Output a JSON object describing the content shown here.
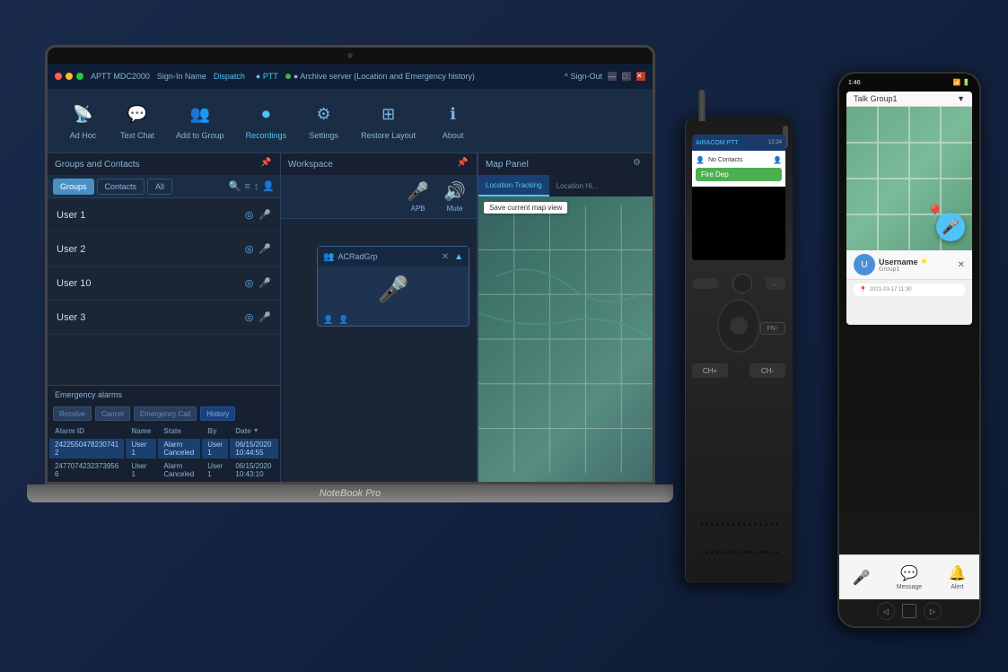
{
  "app": {
    "title": "APTT MDC2000",
    "sign_in_label": "Sign-In Name",
    "user": "Dispatch",
    "ptt_label": "● PTT",
    "archive_label": "● Archive server (Location and Emergency history)",
    "sign_out_label": "^ Sign-Out"
  },
  "toolbar": {
    "items": [
      {
        "id": "adhoc",
        "label": "Ad Hoc",
        "icon": "📡"
      },
      {
        "id": "textchat",
        "label": "Text Chat",
        "icon": "💬"
      },
      {
        "id": "addtogroup",
        "label": "Add to Group",
        "icon": "👥"
      },
      {
        "id": "recordings",
        "label": "Recordings",
        "icon": "⏺"
      },
      {
        "id": "settings",
        "label": "Settings",
        "icon": "⚙"
      },
      {
        "id": "restorelayout",
        "label": "Restore Layout",
        "icon": "⊞"
      },
      {
        "id": "about",
        "label": "About",
        "icon": "ℹ"
      }
    ]
  },
  "groups_panel": {
    "title": "Groups and Contacts",
    "tabs": [
      "Groups",
      "Contacts",
      "All"
    ],
    "active_tab": "Groups",
    "contacts": [
      {
        "name": "User 1",
        "has_location": true,
        "mic_color": "green"
      },
      {
        "name": "User 2",
        "has_location": true,
        "mic_color": "green"
      },
      {
        "name": "User 10",
        "has_location": true,
        "mic_color": "red"
      },
      {
        "name": "User 3",
        "has_location": true,
        "mic_color": "red"
      }
    ]
  },
  "alarms": {
    "title": "Emergency alarms",
    "buttons": [
      "Receive",
      "Cancel",
      "Emergency Call",
      "History"
    ],
    "columns": [
      "Alarm ID",
      "Name",
      "State",
      "By",
      "Date"
    ],
    "rows": [
      {
        "id": "2422550478230741 2",
        "name": "User 1",
        "state": "Alarm Canceled",
        "by": "User 1",
        "date": "06/15/2020 10:44:55",
        "selected": true
      },
      {
        "id": "2477074232373956 6",
        "name": "User 1",
        "state": "Alarm Canceled",
        "by": "User 1",
        "date": "06/15/2020 10:43:10",
        "selected": false
      }
    ]
  },
  "workspace": {
    "title": "Workspace",
    "apb_label": "APB",
    "mute_label": "Mute",
    "group_card": {
      "name": "ACRadGrp",
      "active": true
    }
  },
  "map_panel": {
    "title": "Map Panel",
    "tabs": [
      "Location Tracking",
      "Location Hi..."
    ],
    "active_tab": "Location Tracking",
    "save_btn": "Save current map view"
  },
  "radio": {
    "screen_header": "AIRACOM PTT",
    "time": "12:24",
    "contacts_label": "No Contacts",
    "fire_btn": "Fire Dep"
  },
  "phone": {
    "time": "1:46",
    "talk_group": "Talk Group1",
    "username": "Username",
    "group": "Group1",
    "message_time": "2021-03-17 11:30",
    "bottom_actions": [
      "Message",
      "Alert"
    ],
    "dropdown_label": "Talk Group1"
  },
  "laptop_brand": "NoteBook Pro"
}
